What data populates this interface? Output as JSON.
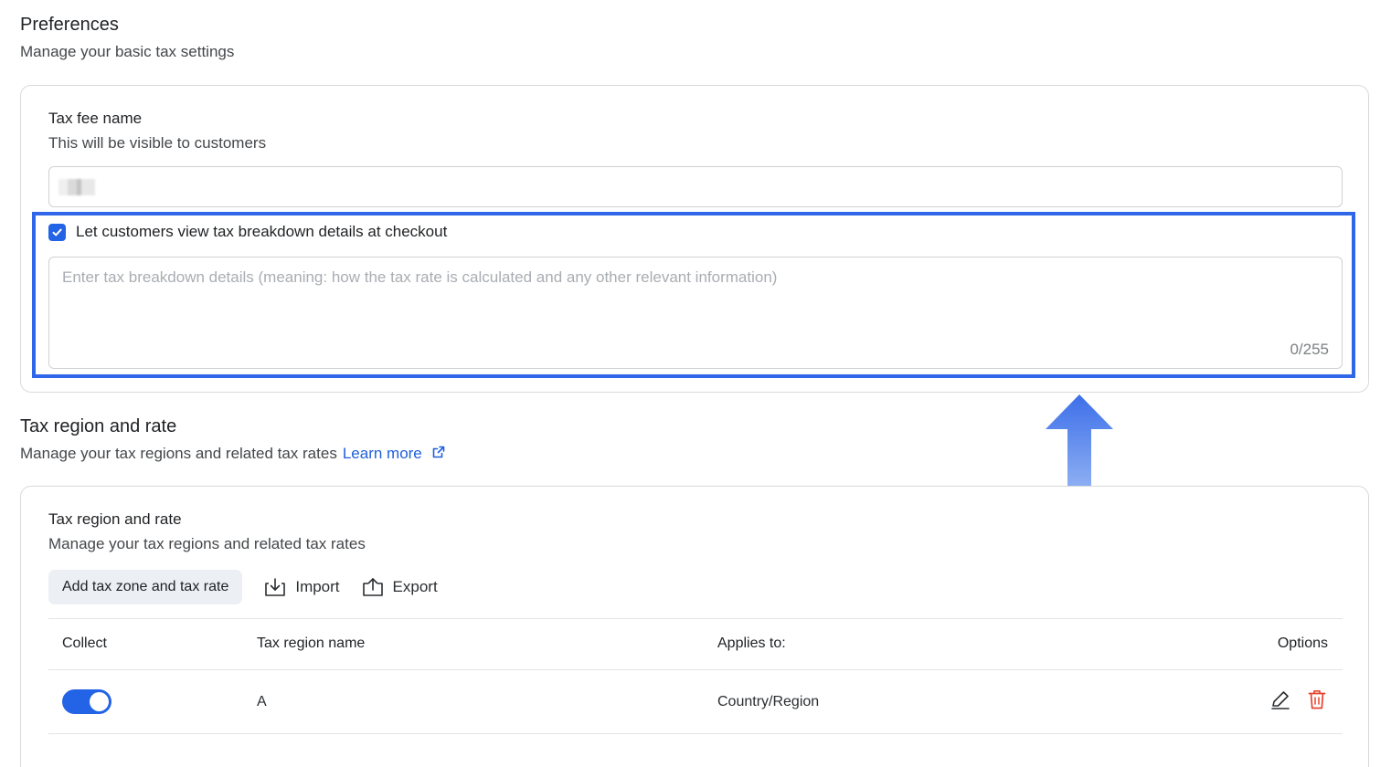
{
  "preferences": {
    "title": "Preferences",
    "subtitle": "Manage your basic tax settings",
    "tax_fee_name": {
      "label": "Tax fee name",
      "helper": "This will be visible to customers",
      "value": ""
    },
    "breakdown": {
      "checkbox_label": "Let customers view tax breakdown details at checkout",
      "checked": true,
      "placeholder": "Enter tax breakdown details (meaning: how the tax rate is calculated and any other relevant information)",
      "counter": "0/255"
    }
  },
  "tax_region": {
    "title": "Tax region and rate",
    "subtitle": "Manage your tax regions and related tax rates",
    "learn_more": "Learn more",
    "card": {
      "title": "Tax region and rate",
      "subtitle": "Manage your tax regions and related tax rates",
      "add_button": "Add tax zone and tax rate",
      "import_button": "Import",
      "export_button": "Export"
    },
    "table": {
      "headers": {
        "collect": "Collect",
        "name": "Tax region name",
        "applies": "Applies to:",
        "options": "Options"
      },
      "rows": [
        {
          "collect": true,
          "name": "A",
          "applies": "Country/Region"
        }
      ]
    }
  },
  "colors": {
    "accent": "#2363e6",
    "highlight": "#2f67e8",
    "link": "#1e5fd9",
    "delete": "#e5442f"
  },
  "icons": {
    "checkbox": "check-icon",
    "learn_more": "external-link-icon",
    "import": "download-tray-icon",
    "export": "upload-tray-icon",
    "edit": "pencil-icon",
    "delete": "trash-icon",
    "annotation": "up-arrow-icon"
  }
}
